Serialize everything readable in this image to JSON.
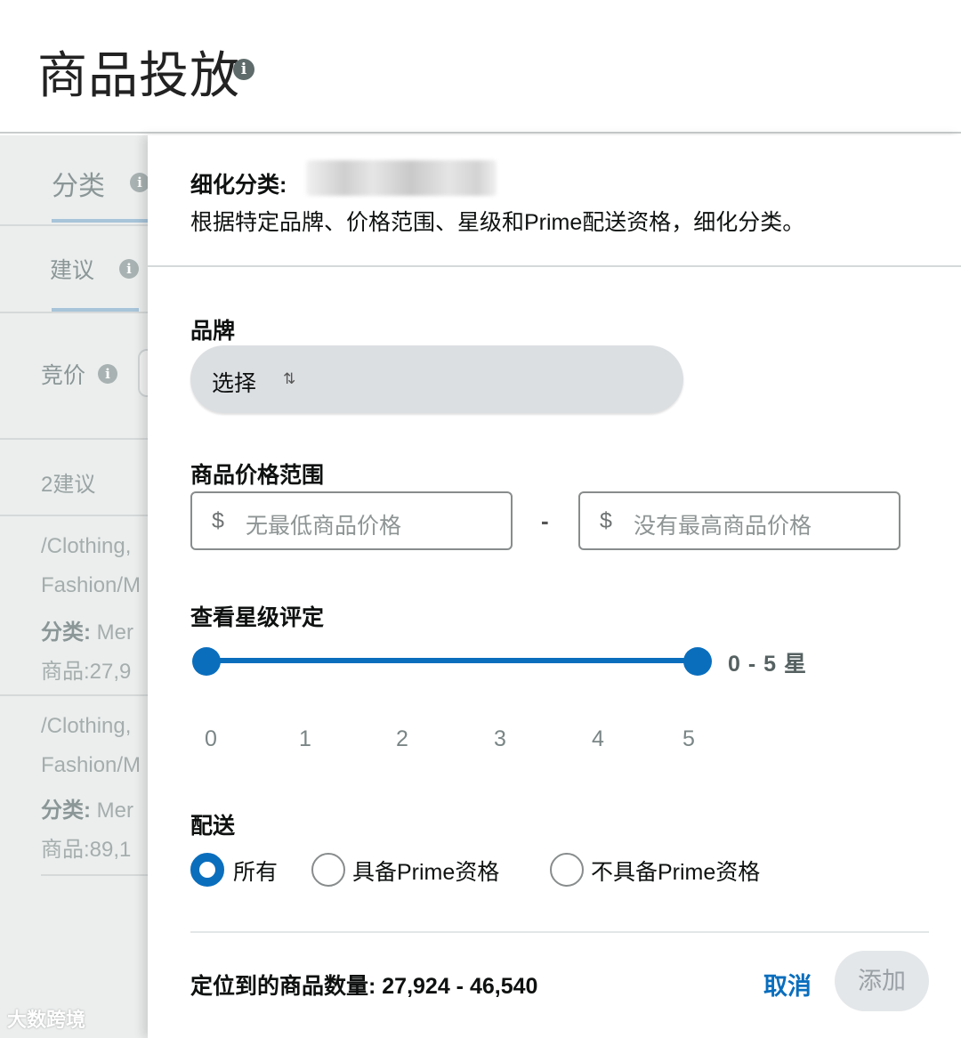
{
  "header": {
    "title": "商品投放"
  },
  "background_panel": {
    "tab_label": "分类",
    "subtab_label": "建议",
    "bid_label": "竞价",
    "suggestion_count": "2建议",
    "items": [
      {
        "path_line1": "/Clothing,",
        "path_line2": "Fashion/M",
        "category_label": "分类:",
        "category_value": "Mer",
        "products_label": "商品:",
        "products_value": "27,9"
      },
      {
        "path_line1": "/Clothing,",
        "path_line2": "Fashion/M",
        "category_label": "分类:",
        "category_value": "Mer",
        "products_label": "商品:",
        "products_value": "89,1"
      }
    ]
  },
  "drawer": {
    "refine_title": "细化分类:",
    "refine_description": "根据特定品牌、价格范围、星级和Prime配送资格，细化分类。",
    "brand": {
      "label": "品牌",
      "select_text": "选择"
    },
    "price_range": {
      "label": "商品价格范围",
      "currency": "$",
      "min_placeholder": "无最低商品价格",
      "max_placeholder": "没有最高商品价格",
      "separator": "-"
    },
    "rating": {
      "label": "查看星级评定",
      "min": 0,
      "max": 5,
      "value_text": "0 - 5 星",
      "ticks": [
        "0",
        "1",
        "2",
        "3",
        "4",
        "5"
      ]
    },
    "delivery": {
      "label": "配送",
      "options": [
        {
          "label": "所有",
          "selected": true
        },
        {
          "label": "具备Prime资格",
          "selected": false
        },
        {
          "label": "不具备Prime资格",
          "selected": false
        }
      ]
    },
    "footer": {
      "count_text": "定位到的商品数量: 27,924 - 46,540",
      "cancel_label": "取消",
      "add_label": "添加"
    }
  },
  "watermark": "大数跨境",
  "colors": {
    "accent": "#0a6ebd",
    "disabled_button_bg": "#e4e7e9",
    "select_bg": "#dcdfe2"
  }
}
